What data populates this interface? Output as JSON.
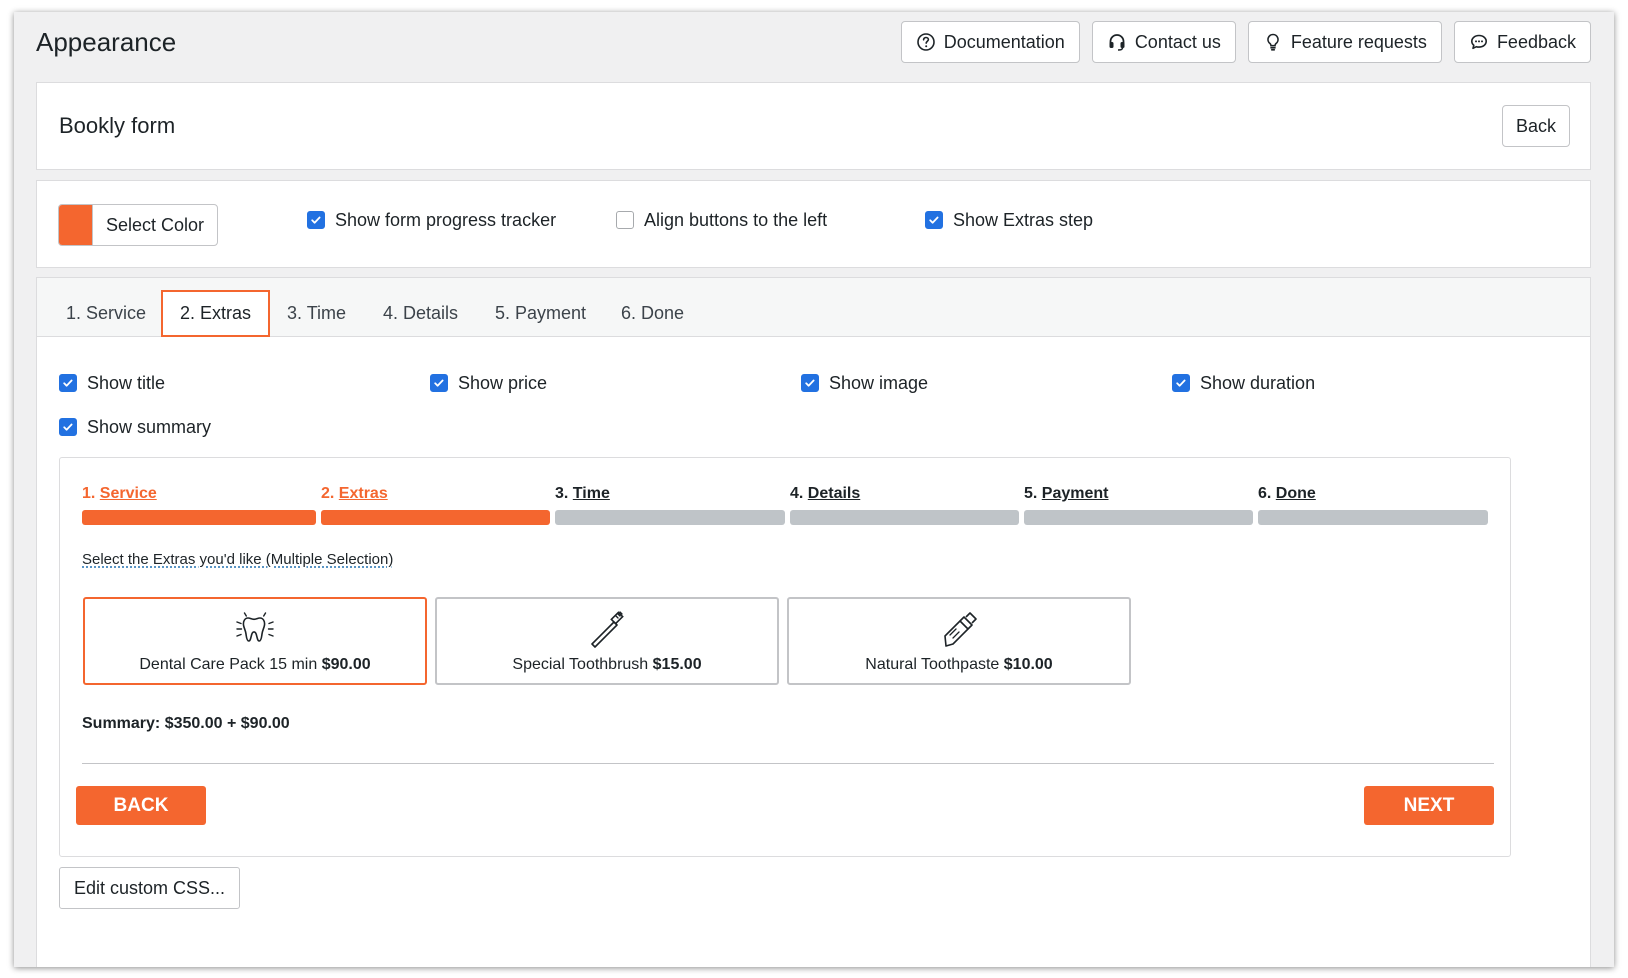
{
  "page": {
    "title": "Appearance"
  },
  "top_buttons": [
    {
      "label": "Documentation",
      "icon": "question-circle-icon"
    },
    {
      "label": "Contact us",
      "icon": "headset-icon"
    },
    {
      "label": "Feature requests",
      "icon": "lightbulb-icon"
    },
    {
      "label": "Feedback",
      "icon": "chat-bubble-icon"
    }
  ],
  "header_card": {
    "title": "Bookly form",
    "back_label": "Back"
  },
  "settings": {
    "select_color_label": "Select Color",
    "selected_color": "#f4662f",
    "show_progress_tracker": {
      "label": "Show form progress tracker",
      "checked": true
    },
    "align_left": {
      "label": "Align buttons to the left",
      "checked": false
    },
    "show_extras": {
      "label": "Show Extras step",
      "checked": true
    }
  },
  "tabs": [
    {
      "label": "1. Service",
      "active": false
    },
    {
      "label": "2. Extras",
      "active": true
    },
    {
      "label": "3. Time",
      "active": false
    },
    {
      "label": "4. Details",
      "active": false
    },
    {
      "label": "5. Payment",
      "active": false
    },
    {
      "label": "6. Done",
      "active": false
    }
  ],
  "options": [
    {
      "label": "Show title",
      "checked": true
    },
    {
      "label": "Show price",
      "checked": true
    },
    {
      "label": "Show image",
      "checked": true
    },
    {
      "label": "Show duration",
      "checked": true
    },
    {
      "label": "Show summary",
      "checked": true
    }
  ],
  "progress": {
    "steps": [
      {
        "num": "1.",
        "name": "Service",
        "done": true
      },
      {
        "num": "2.",
        "name": "Extras",
        "done": true
      },
      {
        "num": "3.",
        "name": "Time",
        "done": false
      },
      {
        "num": "4.",
        "name": "Details",
        "done": false
      },
      {
        "num": "5.",
        "name": "Payment",
        "done": false
      },
      {
        "num": "6.",
        "name": "Done",
        "done": false
      }
    ],
    "active_color": "#f4662f",
    "inactive_color": "#bfc4c8"
  },
  "extras_hint": "Select the Extras you'd like (Multiple Selection)",
  "extras": [
    {
      "name": "Dental Care Pack 15 min",
      "price": "$90.00",
      "icon": "tooth-icon",
      "selected": true
    },
    {
      "name": "Special Toothbrush",
      "price": "$15.00",
      "icon": "toothbrush-icon",
      "selected": false
    },
    {
      "name": "Natural Toothpaste",
      "price": "$10.00",
      "icon": "toothpaste-icon",
      "selected": false
    }
  ],
  "summary": "Summary: $350.00 + $90.00",
  "nav": {
    "back": "BACK",
    "next": "NEXT"
  },
  "edit_css_label": "Edit custom CSS..."
}
